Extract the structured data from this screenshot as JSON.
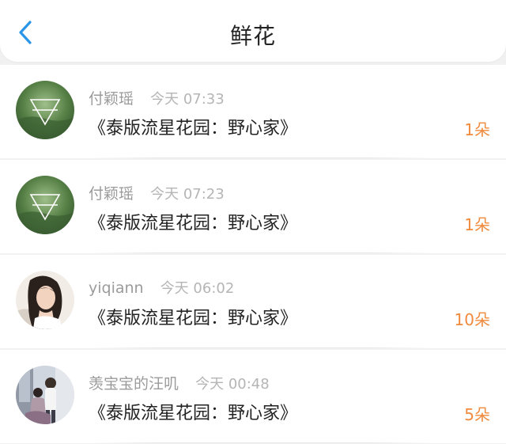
{
  "header": {
    "title": "鲜花",
    "back_icon": "chevron-left-icon",
    "accent_color": "#2b95e8"
  },
  "items": [
    {
      "username": "付颖瑶",
      "time": "今天 07:33",
      "title": "《泰版流星花园：野心家》",
      "count": "1朵",
      "avatar": "forest-triangle-avatar"
    },
    {
      "username": "付颖瑶",
      "time": "今天 07:23",
      "title": "《泰版流星花园：野心家》",
      "count": "1朵",
      "avatar": "forest-triangle-avatar"
    },
    {
      "username": "yiqiann",
      "time": "今天 06:02",
      "title": "《泰版流星花园：野心家》",
      "count": "10朵",
      "avatar": "woman-portrait-avatar"
    },
    {
      "username": "羡宝宝的汪叽",
      "time": "今天 00:48",
      "title": "《泰版流星花园：野心家》",
      "count": "5朵",
      "avatar": "couple-photo-avatar"
    }
  ],
  "colors": {
    "count": "#f08a3c",
    "username": "#9b9b9b",
    "time": "#b5b5b5"
  }
}
